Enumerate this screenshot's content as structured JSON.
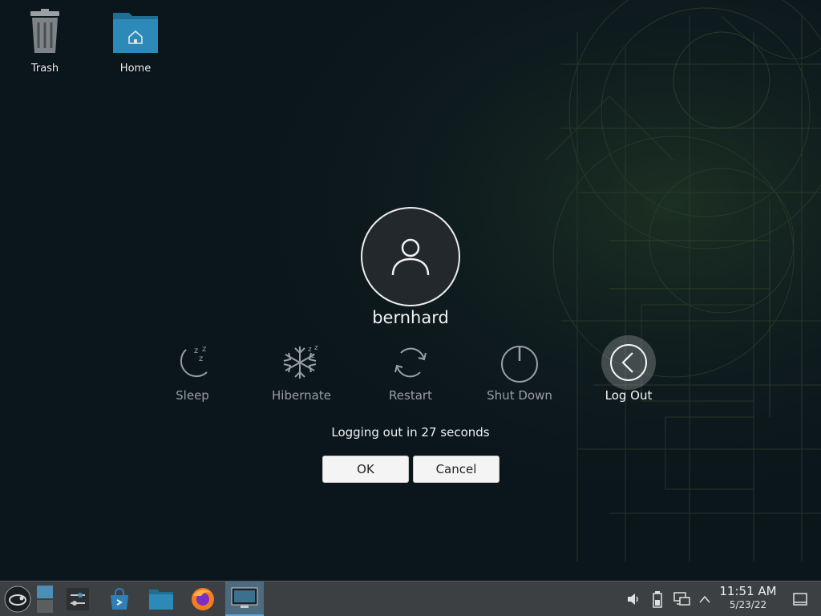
{
  "desktop": {
    "icons": [
      {
        "label": "Trash",
        "icon": "trash-icon"
      },
      {
        "label": "Home",
        "icon": "home-folder-icon"
      }
    ]
  },
  "logout": {
    "username": "bernhard",
    "actions": [
      {
        "label": "Sleep",
        "icon": "sleep-icon",
        "selected": false
      },
      {
        "label": "Hibernate",
        "icon": "snowflake-icon",
        "selected": false
      },
      {
        "label": "Restart",
        "icon": "restart-icon",
        "selected": false
      },
      {
        "label": "Shut Down",
        "icon": "power-icon",
        "selected": false
      },
      {
        "label": "Log Out",
        "icon": "logout-arrow-icon",
        "selected": true
      }
    ],
    "countdown_text": "Logging out in 27 seconds",
    "ok_label": "OK",
    "cancel_label": "Cancel"
  },
  "taskbar": {
    "launcher_icon": "opensuse-launcher-icon",
    "apps": [
      {
        "icon": "pager-icon"
      },
      {
        "icon": "system-settings-icon"
      },
      {
        "icon": "discover-store-icon"
      },
      {
        "icon": "file-manager-icon"
      },
      {
        "icon": "firefox-icon"
      },
      {
        "icon": "monitor-app-icon",
        "active": true
      }
    ],
    "tray": [
      "volume-icon",
      "battery-icon",
      "network-icon",
      "tray-expand-icon"
    ],
    "clock": {
      "time": "11:51 AM",
      "date": "5/23/22"
    },
    "show_desktop_icon": "show-desktop-icon"
  },
  "colors": {
    "background": "#0b161c",
    "taskbar": "#3d4043",
    "accent": "#5fa6d8"
  }
}
